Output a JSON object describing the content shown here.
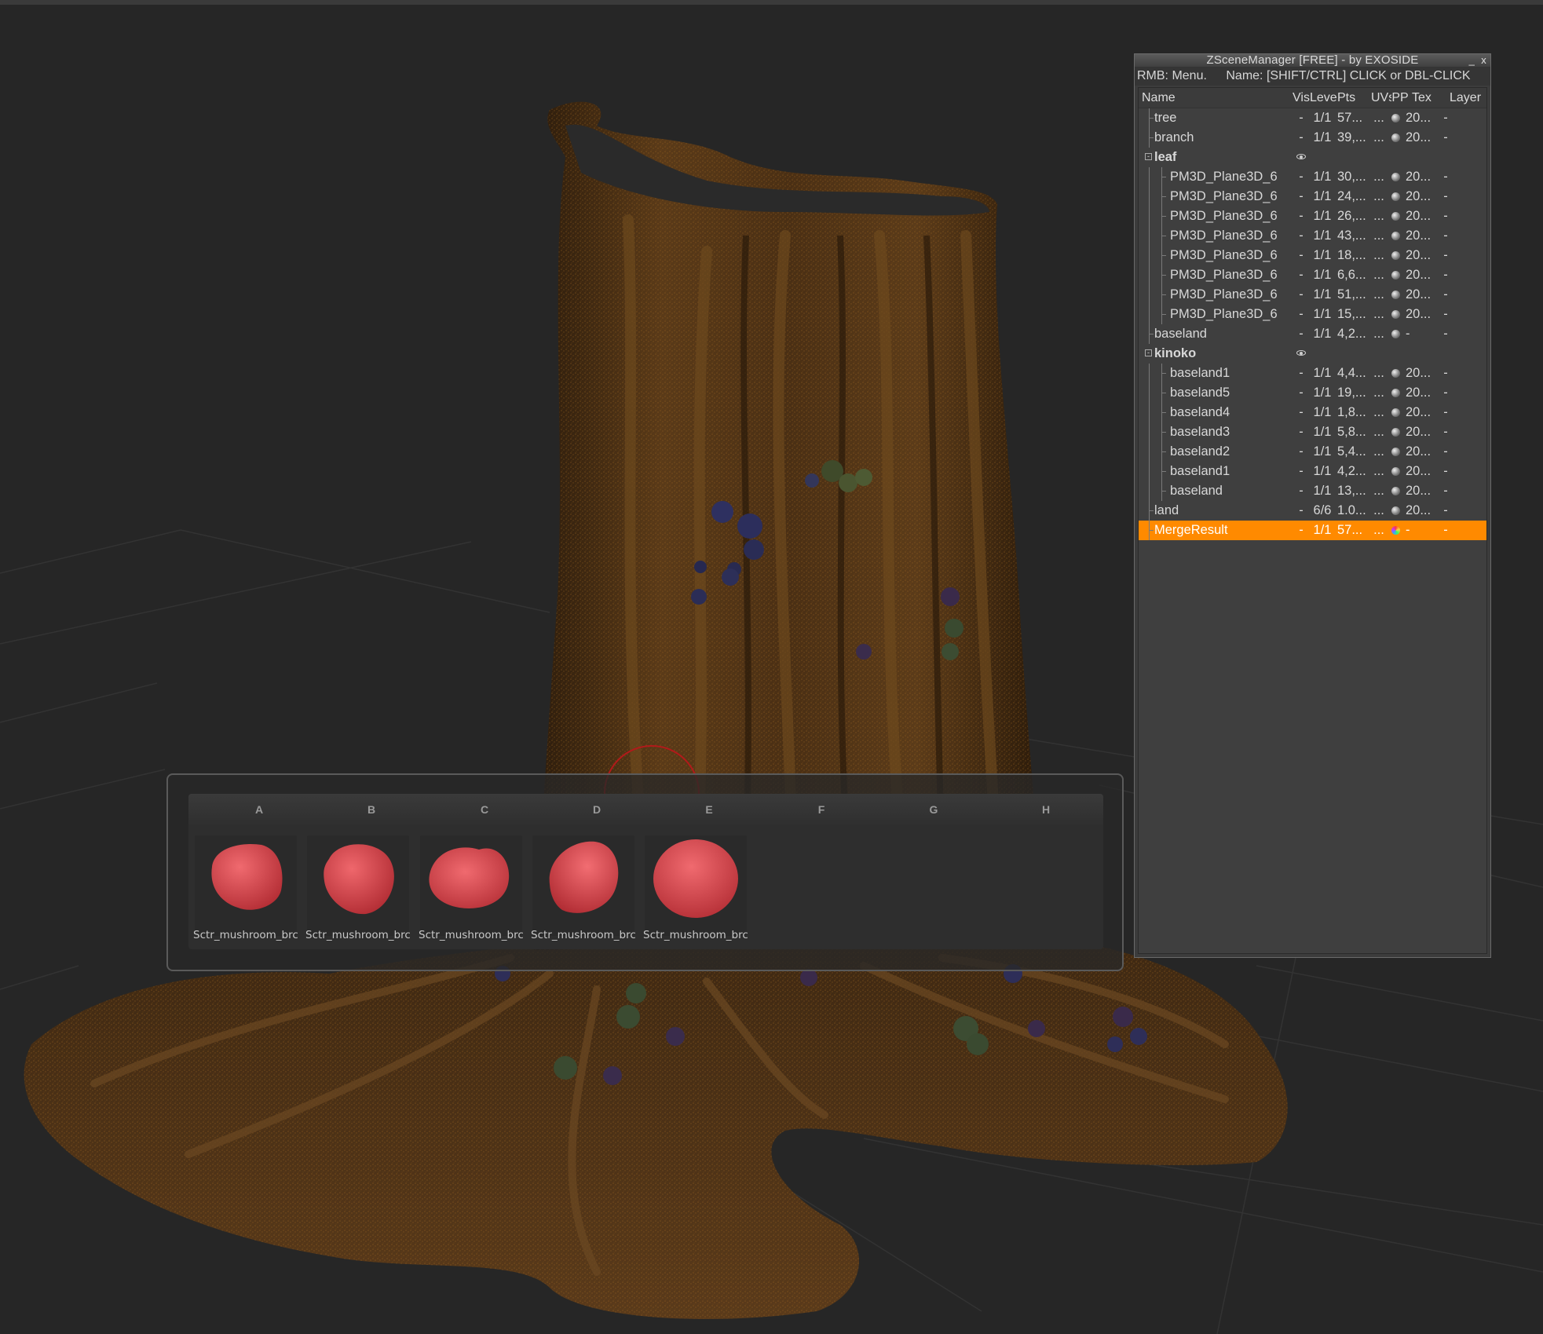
{
  "scene_manager": {
    "title": "ZSceneManager [FREE]  -  by EXOSIDE",
    "minimize_glyph": "_",
    "close_glyph": "x",
    "hint_left": "RMB: Menu.",
    "hint_right": "Name: [SHIFT/CTRL] CLICK or DBL-CLICK",
    "columns": {
      "name": "Name",
      "vis": "Vis",
      "level": "Level",
      "pts": "Pts",
      "uvs": "UVs",
      "pp": "PP",
      "tex": "Tex",
      "layer": "Layer"
    },
    "rows": [
      {
        "name": "tree",
        "vis": "-",
        "level": "1/1",
        "pts": "57...",
        "uvs": "...",
        "pp": "sphere",
        "tex": "20...",
        "layer": "-"
      },
      {
        "name": "branch",
        "vis": "-",
        "level": "1/1",
        "pts": "39,...",
        "uvs": "...",
        "pp": "sphere",
        "tex": "20...",
        "layer": "-"
      },
      {
        "name": "leaf",
        "vis": "eye",
        "level": "",
        "pts": "",
        "uvs": "",
        "pp": "",
        "tex": "",
        "layer": "",
        "group": true,
        "expander": "-"
      },
      {
        "name": "PM3D_Plane3D_6",
        "vis": "-",
        "level": "1/1",
        "pts": "30,...",
        "uvs": "...",
        "pp": "sphere",
        "tex": "20...",
        "layer": "-",
        "child": true
      },
      {
        "name": "PM3D_Plane3D_6",
        "vis": "-",
        "level": "1/1",
        "pts": "24,...",
        "uvs": "...",
        "pp": "sphere",
        "tex": "20...",
        "layer": "-",
        "child": true
      },
      {
        "name": "PM3D_Plane3D_6",
        "vis": "-",
        "level": "1/1",
        "pts": "26,...",
        "uvs": "...",
        "pp": "sphere",
        "tex": "20...",
        "layer": "-",
        "child": true
      },
      {
        "name": "PM3D_Plane3D_6",
        "vis": "-",
        "level": "1/1",
        "pts": "43,...",
        "uvs": "...",
        "pp": "sphere",
        "tex": "20...",
        "layer": "-",
        "child": true
      },
      {
        "name": "PM3D_Plane3D_6",
        "vis": "-",
        "level": "1/1",
        "pts": "18,...",
        "uvs": "...",
        "pp": "sphere",
        "tex": "20...",
        "layer": "-",
        "child": true
      },
      {
        "name": "PM3D_Plane3D_6",
        "vis": "-",
        "level": "1/1",
        "pts": "6,6...",
        "uvs": "...",
        "pp": "sphere",
        "tex": "20...",
        "layer": "-",
        "child": true
      },
      {
        "name": "PM3D_Plane3D_6",
        "vis": "-",
        "level": "1/1",
        "pts": "51,...",
        "uvs": "...",
        "pp": "sphere",
        "tex": "20...",
        "layer": "-",
        "child": true
      },
      {
        "name": "PM3D_Plane3D_6",
        "vis": "-",
        "level": "1/1",
        "pts": "15,...",
        "uvs": "...",
        "pp": "sphere",
        "tex": "20...",
        "layer": "-",
        "child": true
      },
      {
        "name": "baseland",
        "vis": "-",
        "level": "1/1",
        "pts": "4,2...",
        "uvs": "...",
        "pp": "sphere",
        "tex": "-",
        "layer": "-"
      },
      {
        "name": "kinoko",
        "vis": "eye",
        "level": "",
        "pts": "",
        "uvs": "",
        "pp": "",
        "tex": "",
        "layer": "",
        "group": true,
        "expander": "-"
      },
      {
        "name": "baseland1",
        "vis": "-",
        "level": "1/1",
        "pts": "4,4...",
        "uvs": "...",
        "pp": "sphere",
        "tex": "20...",
        "layer": "-",
        "child": true
      },
      {
        "name": "baseland5",
        "vis": "-",
        "level": "1/1",
        "pts": "19,...",
        "uvs": "...",
        "pp": "sphere",
        "tex": "20...",
        "layer": "-",
        "child": true
      },
      {
        "name": "baseland4",
        "vis": "-",
        "level": "1/1",
        "pts": "1,8...",
        "uvs": "...",
        "pp": "sphere",
        "tex": "20...",
        "layer": "-",
        "child": true
      },
      {
        "name": "baseland3",
        "vis": "-",
        "level": "1/1",
        "pts": "5,8...",
        "uvs": "...",
        "pp": "sphere",
        "tex": "20...",
        "layer": "-",
        "child": true
      },
      {
        "name": "baseland2",
        "vis": "-",
        "level": "1/1",
        "pts": "5,4...",
        "uvs": "...",
        "pp": "sphere",
        "tex": "20...",
        "layer": "-",
        "child": true
      },
      {
        "name": "baseland1",
        "vis": "-",
        "level": "1/1",
        "pts": "4,2...",
        "uvs": "...",
        "pp": "sphere",
        "tex": "20...",
        "layer": "-",
        "child": true
      },
      {
        "name": "baseland",
        "vis": "-",
        "level": "1/1",
        "pts": "13,...",
        "uvs": "...",
        "pp": "sphere",
        "tex": "20...",
        "layer": "-",
        "child": true
      },
      {
        "name": "land",
        "vis": "-",
        "level": "6/6",
        "pts": "1.0...",
        "uvs": "...",
        "pp": "sphere",
        "tex": "20...",
        "layer": "-"
      },
      {
        "name": "MergeResult",
        "vis": "-",
        "level": "1/1",
        "pts": "57...",
        "uvs": "...",
        "pp": "color-sphere",
        "tex": "-",
        "layer": "-",
        "selected": true
      }
    ]
  },
  "palette": {
    "letters": [
      "A",
      "B",
      "C",
      "D",
      "E",
      "F",
      "G",
      "H"
    ],
    "slots": [
      {
        "label": "Sctr_mushroom_brc"
      },
      {
        "label": "Sctr_mushroom_brc"
      },
      {
        "label": "Sctr_mushroom_brc"
      },
      {
        "label": "Sctr_mushroom_brc"
      },
      {
        "label": "Sctr_mushroom_brc"
      }
    ]
  },
  "colors": {
    "background": "#262626",
    "bark": "#4a3018",
    "bark_highlight": "#8a5a22",
    "selection": "#ff8a00",
    "mushroom_thumb": "#d9434a"
  }
}
